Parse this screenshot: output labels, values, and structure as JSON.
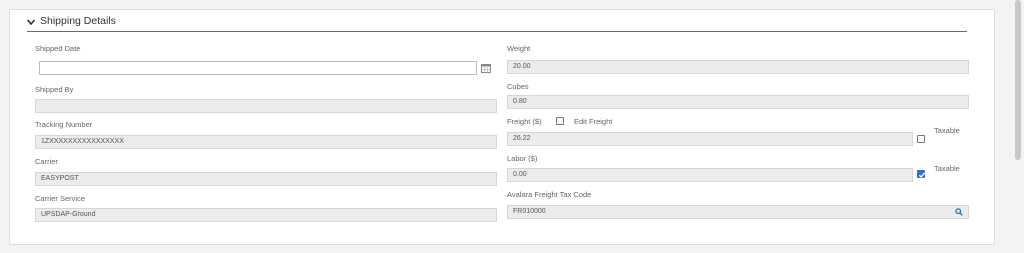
{
  "section": {
    "title": "Shipping Details"
  },
  "left": {
    "shipped_date": {
      "label": "Shipped Date",
      "value": ""
    },
    "shipped_by": {
      "label": "Shipped By",
      "value": ""
    },
    "tracking_number": {
      "label": "Tracking Number",
      "value": "1ZXXXXXXXXXXXXXXXX"
    },
    "carrier": {
      "label": "Carrier",
      "value": "EASYPOST"
    },
    "carrier_service": {
      "label": "Carrier Service",
      "value": "UPSDAP-Ground"
    }
  },
  "right": {
    "weight": {
      "label": "Weight",
      "value": "20.00"
    },
    "cubes": {
      "label": "Cubes",
      "value": "0.80"
    },
    "freight": {
      "label": "Freight ($)",
      "edit_label": "Edit Freight",
      "edit_checked": false,
      "value": "26.22",
      "taxable_label": "Taxable",
      "taxable_checked": false
    },
    "labor": {
      "label": "Labor ($)",
      "value": "0.00",
      "taxable_label": "Taxable",
      "taxable_checked": true
    },
    "avalara": {
      "label": "Avalara Freight Tax Code",
      "value": "FR010000"
    }
  },
  "icons": {
    "section_toggle": "chevron-down-icon",
    "date_picker": "calendar-icon",
    "lookup": "search-icon"
  },
  "colors": {
    "accent": "#2b7ea1",
    "checkbox_checked": "#2b6fcf"
  }
}
